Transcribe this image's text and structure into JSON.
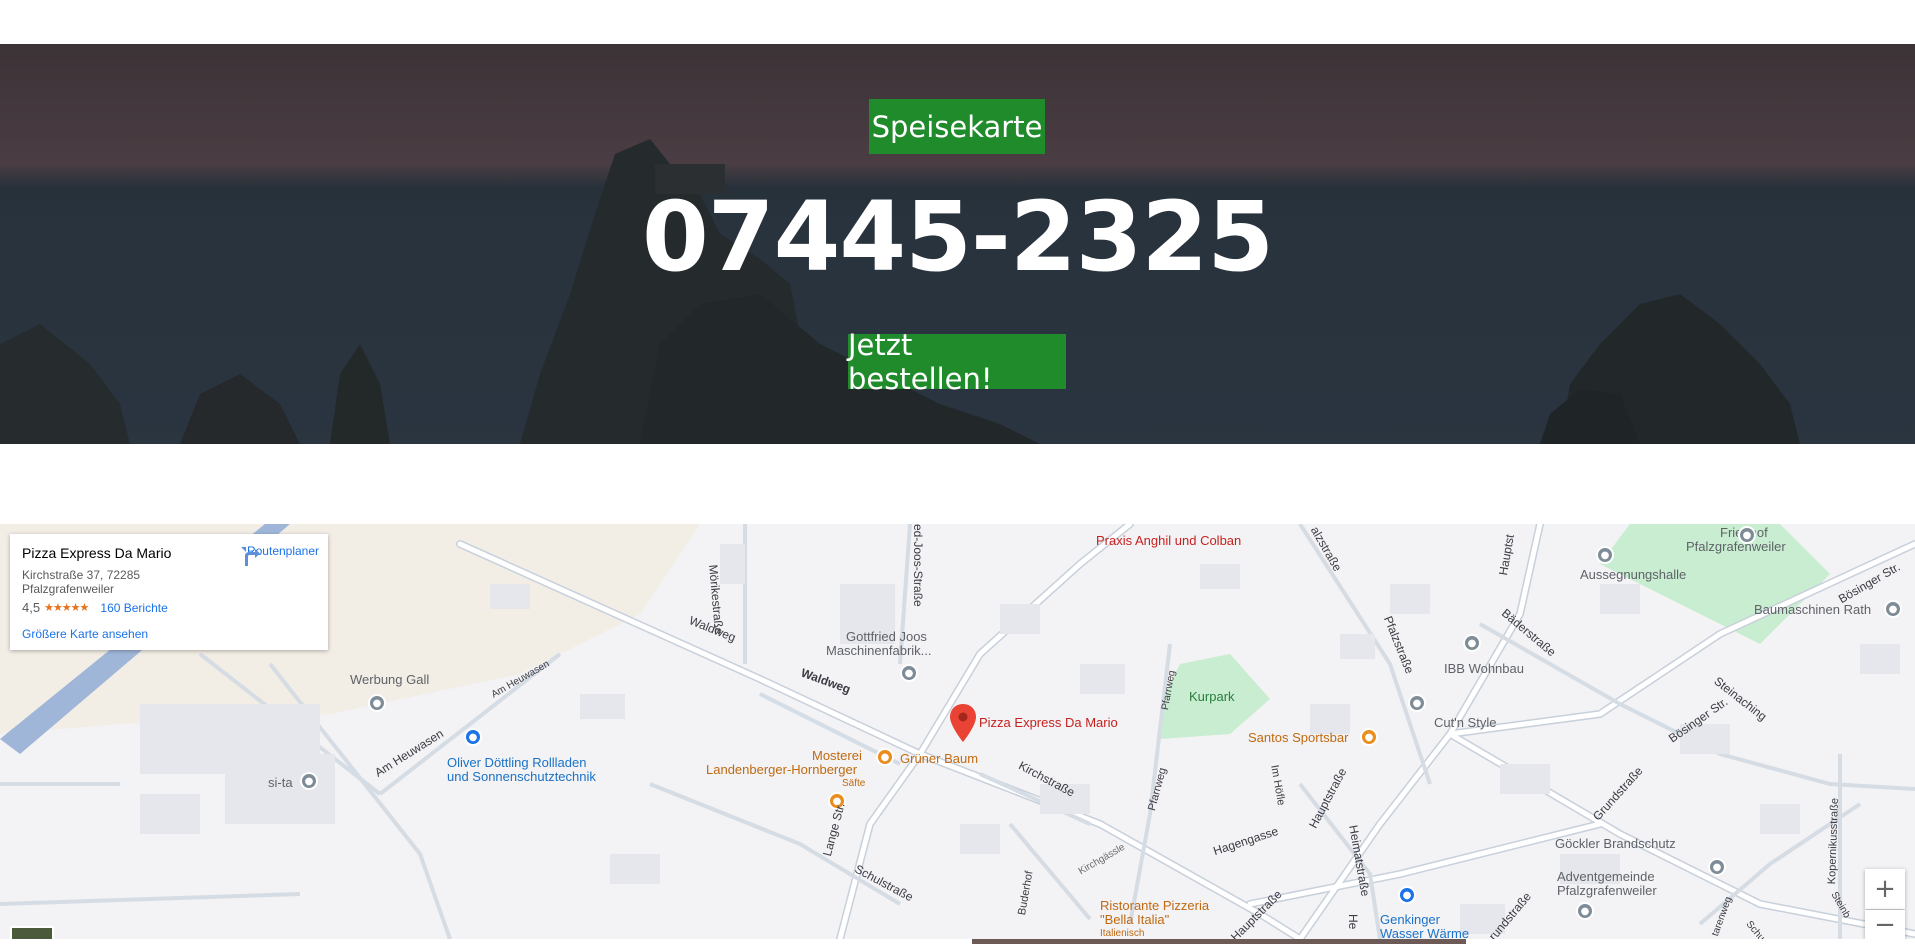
{
  "hero": {
    "menu_button": "Speisekarte",
    "phone": "07445-2325",
    "order_button": "Jetzt bestellen!"
  },
  "map": {
    "info_card": {
      "title": "Pizza Express Da Mario",
      "address_line1": "Kirchstraße 37, 72285",
      "address_line2": "Pfalzgrafenweiler",
      "rating": "4,5",
      "stars": "★★★★★",
      "reviews": "160 Berichte",
      "bigger_map": "Größere Karte ansehen",
      "route_label": "Routenplaner"
    },
    "marker_label": "Pizza Express Da Mario",
    "pois": {
      "praxis": "Praxis Anghil und Colban",
      "friedhof": "Friedhof",
      "friedhof2": "Pfalzgrafenweiler",
      "aussegnungshalle": "Aussegnungshalle",
      "baumaschinen": "Baumaschinen Rath",
      "gottfried1": "Gottfried Joos",
      "gottfried2": "Maschinenfabrik...",
      "werbung": "Werbung Gall",
      "ibb": "IBB Wohnbau",
      "kurpark": "Kurpark",
      "cutnstyle": "Cut'n Style",
      "santos": "Santos Sportsbar",
      "oliver1": "Oliver Döttling Rollladen",
      "oliver2": "und Sonnenschutztechnik",
      "sita": "si-ta",
      "mosterei1": "Mosterei",
      "mosterei2": "Landenberger-Hornberger",
      "saefte": "Säfte",
      "gruener_baum": "Grüner Baum",
      "goeckler": "Göckler Brandschutz",
      "advent1": "Adventgemeinde",
      "advent2": "Pfalzgrafenweiler",
      "ristorante1": "Ristorante Pizzeria",
      "ristorante2": "\"Bella Italia\"",
      "italienisch": "Italienisch",
      "genkinger1": "Genkinger",
      "genkinger2": "Wasser Wärme"
    },
    "streets": {
      "moerikestrasse": "Mörikestraße",
      "joosstrasse": "ed-Joos-Straße",
      "waldweg1": "Waldweg",
      "waldweg2": "Waldweg",
      "am_heuwasen1": "Am Heuwasen",
      "am_heuwasen2": "Am Heuwasen",
      "kirchstrasse": "Kirchstraße",
      "lange_str": "Lange Str.",
      "schulstrasse": "Schulstraße",
      "buderhof": "Buderhof",
      "kirchgaessle": "Kirchgässle",
      "pfarrweg1": "Pfarrweg",
      "pfarrweg2": "Pfarrweg",
      "hagengasse": "Hagengasse",
      "im_hoefle": "Im Höfle",
      "hauptstrasse1": "Hauptstraße",
      "hauptstrasse2": "Hauptstraße",
      "hauptstrasse3": "Hauptst",
      "hauptstrasse4": "Hauptstraße",
      "heimatstrasse": "Heimatstraße",
      "pfalzstrasse1": "Pfalzstraße",
      "pfalzstrasse2": "alzstraße",
      "baederstrasse": "Bäderstraße",
      "grundstrasse1": "Grundstraße",
      "grundstrasse2": "rundstraße",
      "boesinger1": "Bösinger Str.",
      "boesinger2": "Bösinger Str.",
      "steinaching": "Steinaching",
      "kopernikus": "Kopernikusstraße",
      "he": "He",
      "starenweg": "tarenweg",
      "schu": "Schu",
      "steini": "Steinb"
    },
    "zoom_in": "+",
    "zoom_out": "−"
  }
}
